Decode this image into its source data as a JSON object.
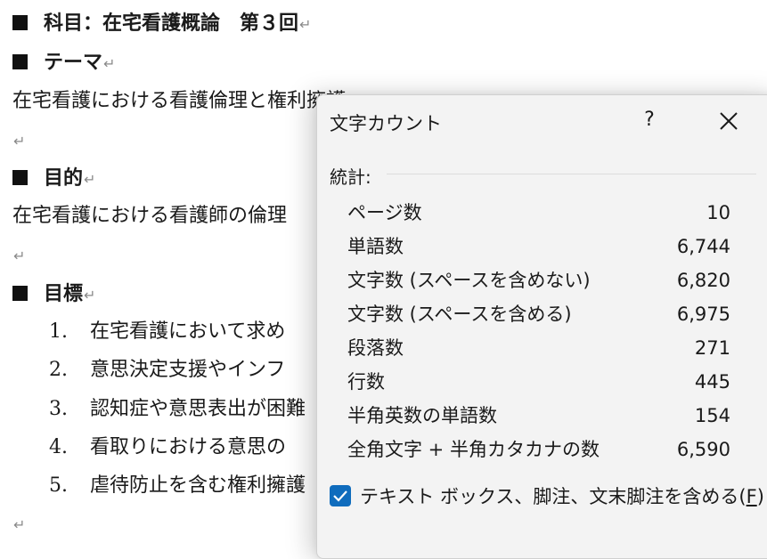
{
  "document": {
    "heading_subject": "科目：在宅看護概論　第３回",
    "heading_theme": "テーマ",
    "theme_text": "在宅看護における看護倫理と権利擁護",
    "heading_purpose": "目的",
    "purpose_text": "在宅看護における看護師の倫理",
    "heading_goals": "目標",
    "goals": [
      {
        "num": "1.",
        "text": "在宅看護において求め"
      },
      {
        "num": "2.",
        "text": "意思決定支援やインフ"
      },
      {
        "num": "3.",
        "text": "認知症や意思表出が困難"
      },
      {
        "num": "4.",
        "text": "看取りにおける意思の"
      },
      {
        "num": "5.",
        "text": "虐待防止を含む権利擁護"
      }
    ],
    "paragraph_mark": "↵"
  },
  "dialog": {
    "title": "文字カウント",
    "help_label": "?",
    "section_label": "統計:",
    "stats": [
      {
        "label": "ページ数",
        "value": "10"
      },
      {
        "label": "単語数",
        "value": "6,744"
      },
      {
        "label": "文字数 (スペースを含めない)",
        "value": "6,820"
      },
      {
        "label": "文字数 (スペースを含める)",
        "value": "6,975"
      },
      {
        "label": "段落数",
        "value": "271"
      },
      {
        "label": "行数",
        "value": "445"
      },
      {
        "label": "半角英数の単語数",
        "value": "154"
      },
      {
        "label": "全角文字 + 半角カタカナの数",
        "value": "6,590"
      }
    ],
    "checkbox": {
      "label": "テキスト ボックス、脚注、文末脚注を含める(",
      "access_key": "F",
      "label_end": ")",
      "checked": true
    },
    "accent_color": "#0f6cbd"
  }
}
